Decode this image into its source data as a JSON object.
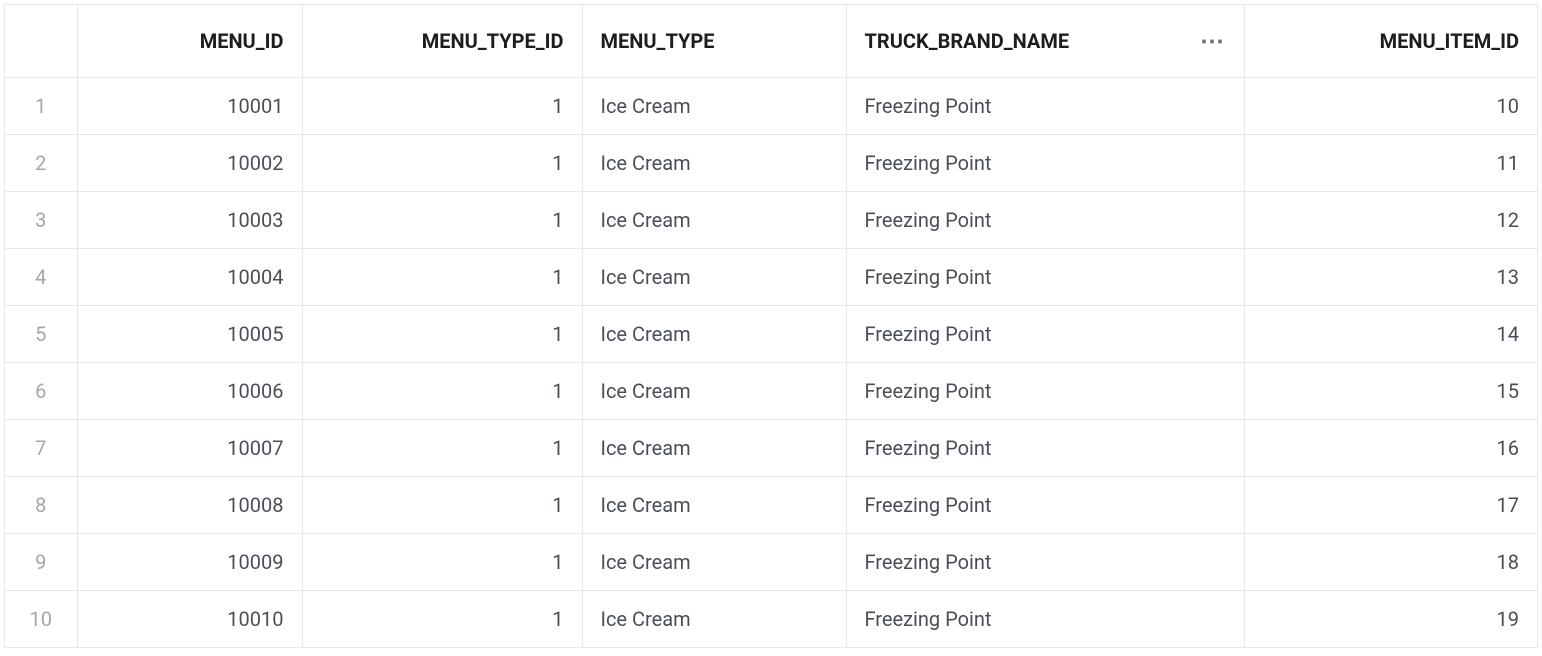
{
  "table": {
    "columns": [
      {
        "key": "menu_id",
        "label": "MENU_ID",
        "type": "number",
        "has_actions": false
      },
      {
        "key": "menu_type_id",
        "label": "MENU_TYPE_ID",
        "type": "number",
        "has_actions": false
      },
      {
        "key": "menu_type",
        "label": "MENU_TYPE",
        "type": "text",
        "has_actions": false
      },
      {
        "key": "truck_brand_name",
        "label": "TRUCK_BRAND_NAME",
        "type": "text",
        "has_actions": true
      },
      {
        "key": "menu_item_id",
        "label": "MENU_ITEM_ID",
        "type": "number",
        "has_actions": false
      }
    ],
    "rows": [
      {
        "index": 1,
        "menu_id": "10001",
        "menu_type_id": "1",
        "menu_type": "Ice Cream",
        "truck_brand_name": "Freezing Point",
        "menu_item_id": "10"
      },
      {
        "index": 2,
        "menu_id": "10002",
        "menu_type_id": "1",
        "menu_type": "Ice Cream",
        "truck_brand_name": "Freezing Point",
        "menu_item_id": "11"
      },
      {
        "index": 3,
        "menu_id": "10003",
        "menu_type_id": "1",
        "menu_type": "Ice Cream",
        "truck_brand_name": "Freezing Point",
        "menu_item_id": "12"
      },
      {
        "index": 4,
        "menu_id": "10004",
        "menu_type_id": "1",
        "menu_type": "Ice Cream",
        "truck_brand_name": "Freezing Point",
        "menu_item_id": "13"
      },
      {
        "index": 5,
        "menu_id": "10005",
        "menu_type_id": "1",
        "menu_type": "Ice Cream",
        "truck_brand_name": "Freezing Point",
        "menu_item_id": "14"
      },
      {
        "index": 6,
        "menu_id": "10006",
        "menu_type_id": "1",
        "menu_type": "Ice Cream",
        "truck_brand_name": "Freezing Point",
        "menu_item_id": "15"
      },
      {
        "index": 7,
        "menu_id": "10007",
        "menu_type_id": "1",
        "menu_type": "Ice Cream",
        "truck_brand_name": "Freezing Point",
        "menu_item_id": "16"
      },
      {
        "index": 8,
        "menu_id": "10008",
        "menu_type_id": "1",
        "menu_type": "Ice Cream",
        "truck_brand_name": "Freezing Point",
        "menu_item_id": "17"
      },
      {
        "index": 9,
        "menu_id": "10009",
        "menu_type_id": "1",
        "menu_type": "Ice Cream",
        "truck_brand_name": "Freezing Point",
        "menu_item_id": "18"
      },
      {
        "index": 10,
        "menu_id": "10010",
        "menu_type_id": "1",
        "menu_type": "Ice Cream",
        "truck_brand_name": "Freezing Point",
        "menu_item_id": "19"
      }
    ],
    "ellipsis_glyph": "⋯"
  }
}
